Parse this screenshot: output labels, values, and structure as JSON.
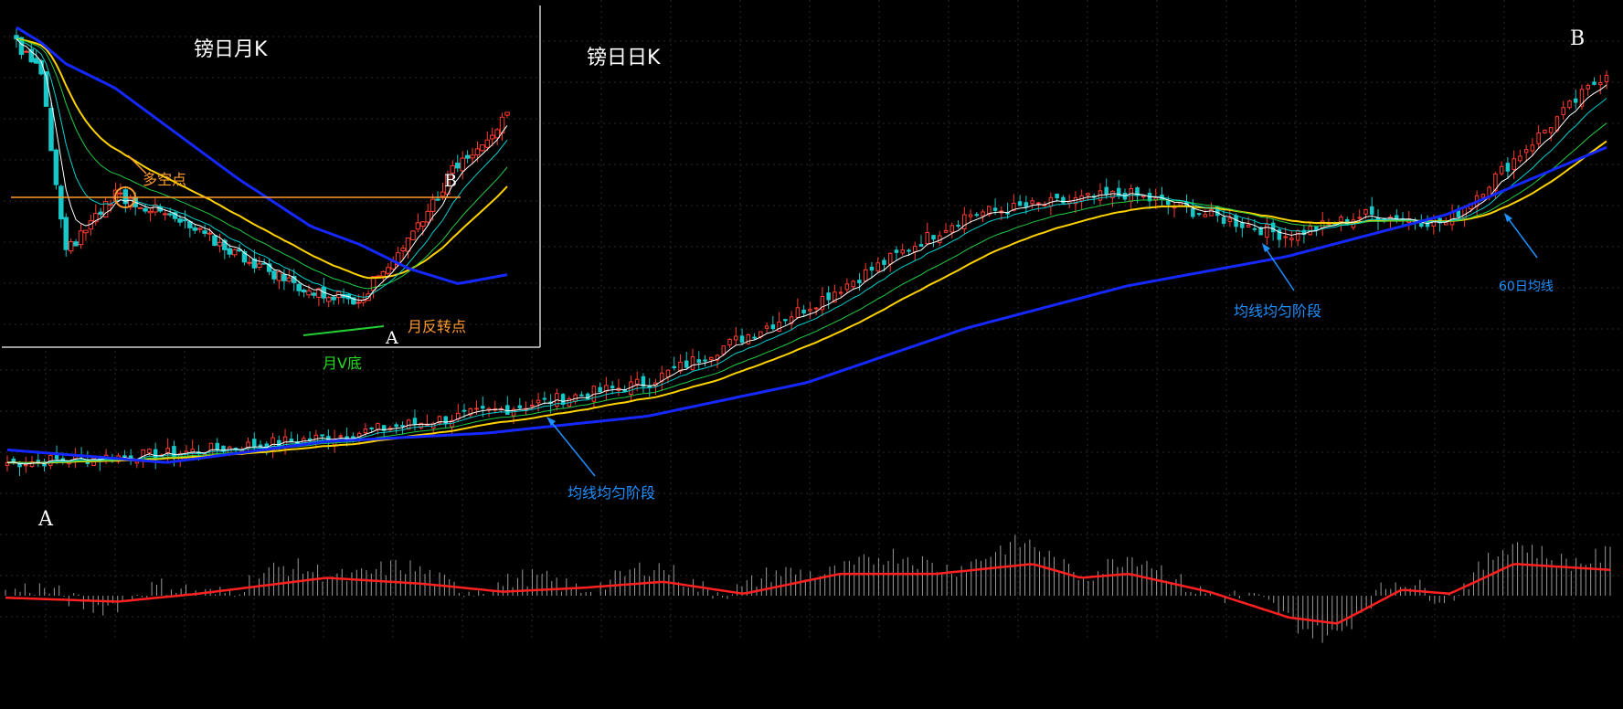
{
  "labels": {
    "monthly_title": "镑日月K",
    "daily_title": "镑日日K",
    "point_b_daily": "B",
    "point_a_daily": "A",
    "point_b_monthly": "B",
    "point_a_monthly": "A",
    "long_short_point": "多空点",
    "monthly_reversal": "月反转点",
    "monthly_v_bottom": "月V底",
    "ma_uniform_1": "均线均匀阶段",
    "ma_uniform_2": "均线均匀阶段",
    "ma60": "60日均线"
  },
  "colors": {
    "background": "#000000",
    "grid": "#2a2a2a",
    "up_candle": "#ff3b2f",
    "down_candle": "#18c8c8",
    "ma_short": "#ffffff",
    "ma_mid": "#00d0d0",
    "ma_green": "#22cc44",
    "ma_yellow": "#ffd200",
    "ma60_blue": "#1428ff",
    "macd_line": "#ff2020",
    "macd_hist": "#9a9a9a",
    "annotation_orange": "#ff9a2e",
    "annotation_green": "#22dd22",
    "annotation_blue": "#1e90ff"
  },
  "chart_data": [
    {
      "name": "镑日日K",
      "type": "candlestick",
      "x_points": [
        0,
        0.1,
        0.2,
        0.3,
        0.4,
        0.5,
        0.6,
        0.7,
        0.8,
        0.85,
        0.9,
        1.0
      ],
      "close_path": [
        0.03,
        0.05,
        0.09,
        0.15,
        0.22,
        0.4,
        0.62,
        0.67,
        0.57,
        0.62,
        0.6,
        0.96
      ],
      "ma60_path": [
        0.06,
        0.03,
        0.08,
        0.1,
        0.14,
        0.22,
        0.35,
        0.45,
        0.52,
        0.57,
        0.62,
        0.78
      ]
    },
    {
      "name": "镑日月K",
      "type": "candlestick",
      "x_points": [
        0,
        0.05,
        0.1,
        0.2,
        0.3,
        0.45,
        0.6,
        0.7,
        0.8,
        0.9,
        1.0
      ],
      "close_path": [
        0.95,
        0.85,
        0.25,
        0.45,
        0.38,
        0.25,
        0.12,
        0.1,
        0.3,
        0.55,
        0.7
      ],
      "ma60_path": [
        1.0,
        0.95,
        0.88,
        0.8,
        0.68,
        0.5,
        0.34,
        0.28,
        0.2,
        0.15,
        0.18
      ]
    },
    {
      "name": "MACD",
      "type": "line+histogram",
      "x_points": [
        0,
        0.07,
        0.12,
        0.2,
        0.26,
        0.31,
        0.36,
        0.41,
        0.46,
        0.52,
        0.58,
        0.64,
        0.67,
        0.7,
        0.75,
        0.8,
        0.83,
        0.87,
        0.9,
        0.94,
        1.0
      ],
      "line_path": [
        -0.05,
        -0.15,
        0.05,
        0.45,
        0.3,
        0.1,
        0.2,
        0.35,
        0.05,
        0.55,
        0.55,
        0.8,
        0.45,
        0.55,
        0.1,
        -0.55,
        -0.7,
        0.15,
        0.05,
        0.8,
        0.65
      ]
    }
  ]
}
